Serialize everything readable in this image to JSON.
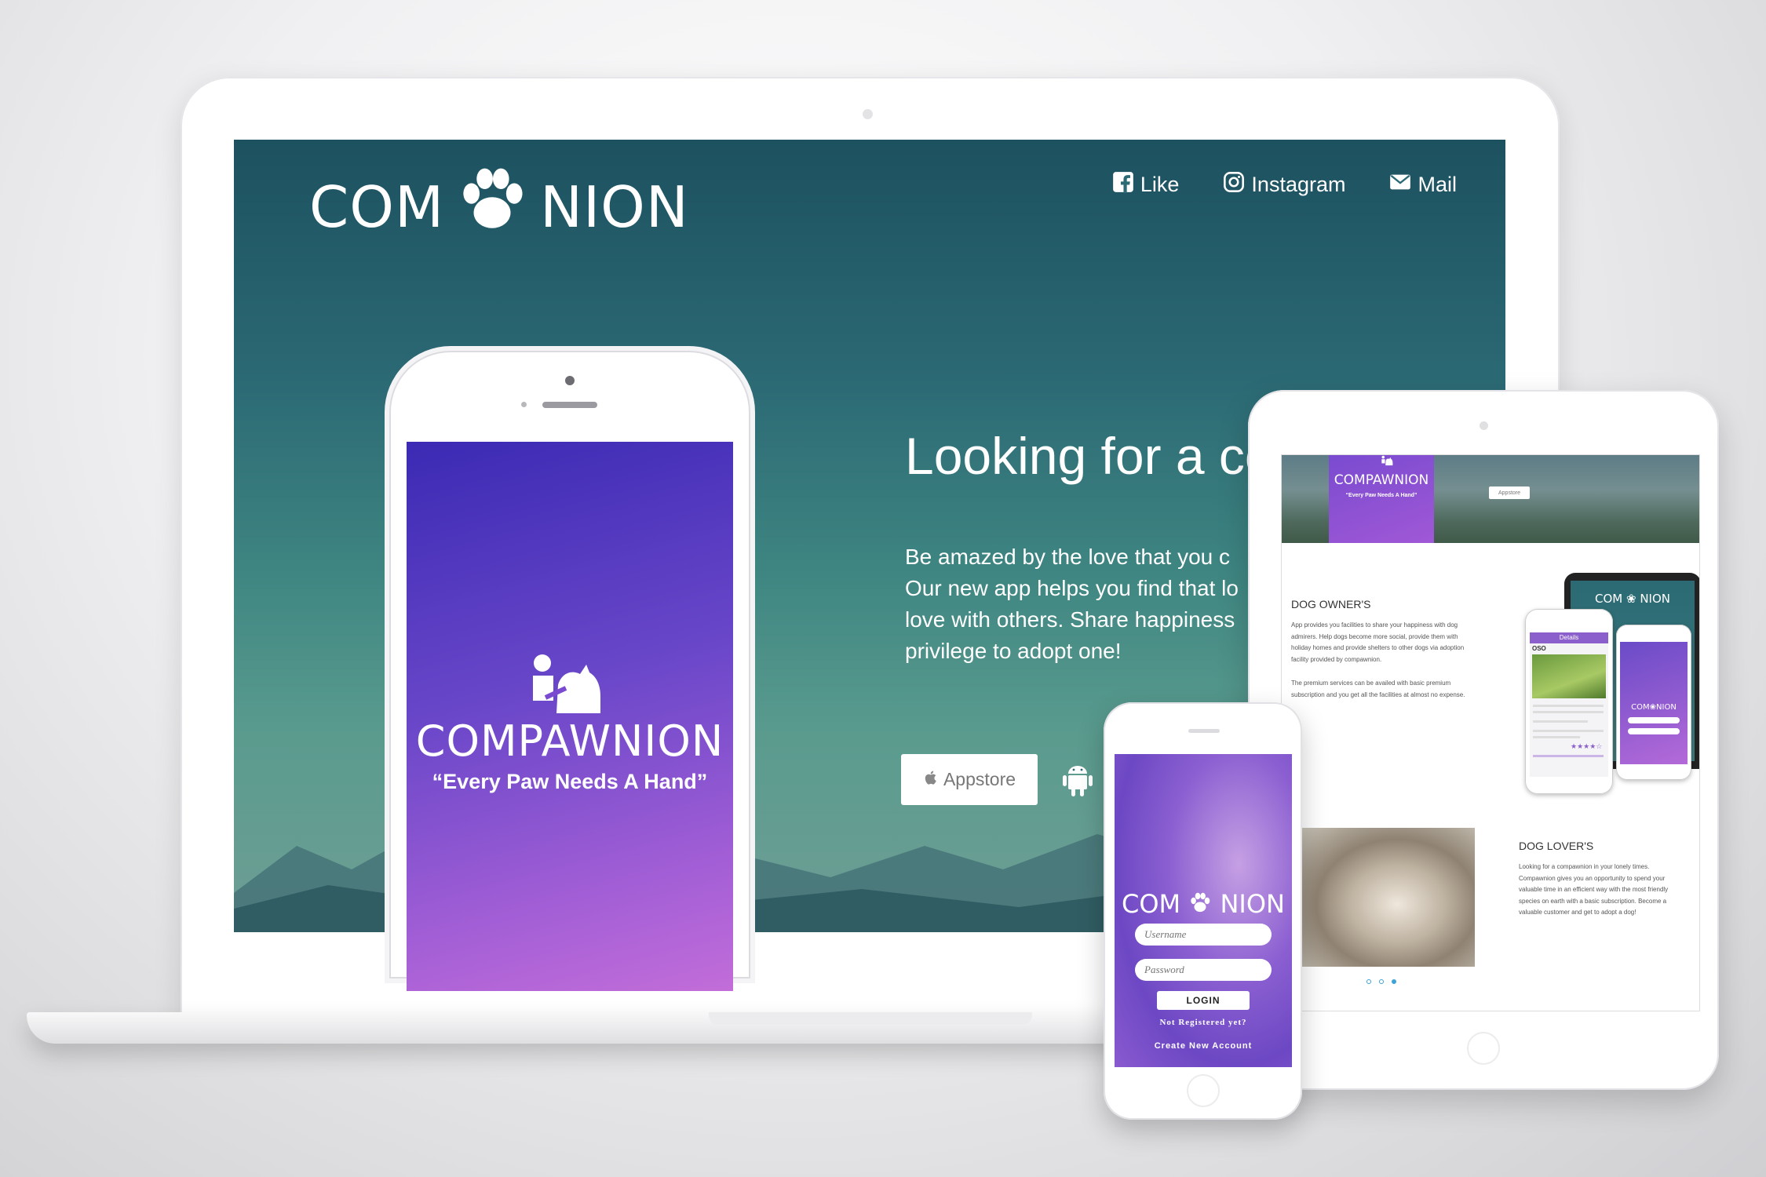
{
  "site": {
    "logo_left": "COM",
    "logo_right": "NION",
    "nav": [
      {
        "label": "Like",
        "icon": "facebook-icon"
      },
      {
        "label": "Instagram",
        "icon": "instagram-icon"
      },
      {
        "label": "Mail",
        "icon": "mail-icon"
      }
    ],
    "hero_heading": "Looking for a co",
    "hero_lines": [
      "Be amazed by the love that you c",
      "Our new app helps you find that lo",
      "love with others. Share happiness",
      "privilege to adopt one!"
    ],
    "appstore_label": "Appstore",
    "android_icon": "android-icon"
  },
  "splash": {
    "brand": "COMPAWNION",
    "tagline": "“Every Paw Needs A Hand”"
  },
  "tablet": {
    "banner_brand": "COMPAWNION",
    "banner_tagline": "“Every Paw Needs A Hand”",
    "banner_store": "Appstore",
    "owners_heading": "DOG OWNER'S",
    "owners_p1": "App provides you facilities to share your happiness with dog admirers. Help dogs become more social, provide them with holiday homes and provide shelters to other dogs via adoption facility provided by compawnion.",
    "owners_p2": "The premium services can be availed with basic premium subscription and you get all the facilities at almost no expense.",
    "mockup_logo_left": "COM",
    "mockup_logo_right": "NION",
    "mockup_details": "Details",
    "mockup_dog_name": "OSO",
    "mockup_phone_logo_left": "COM",
    "mockup_phone_logo_right": "NION",
    "lovers_heading": "DOG LOVER'S",
    "lovers_p": "Looking for a compawnion in your lonely times. Compawnion gives you an opportunity to spend your valuable time in an efficient way with the most friendly species on earth with a basic subscription. Become a valuable customer and get to adopt a dog!"
  },
  "phone": {
    "logo_left": "COM",
    "logo_right": "NION",
    "username_placeholder": "Username",
    "password_placeholder": "Password",
    "login_label": "LOGIN",
    "not_registered": "Not Registered yet?",
    "create_account": "Create New Account"
  },
  "colors": {
    "hero_teal": "#2b6974",
    "brand_purple": "#7a4bd0",
    "brand_violet": "#c26dd9",
    "carousel_dot": "#3aa3d8"
  }
}
